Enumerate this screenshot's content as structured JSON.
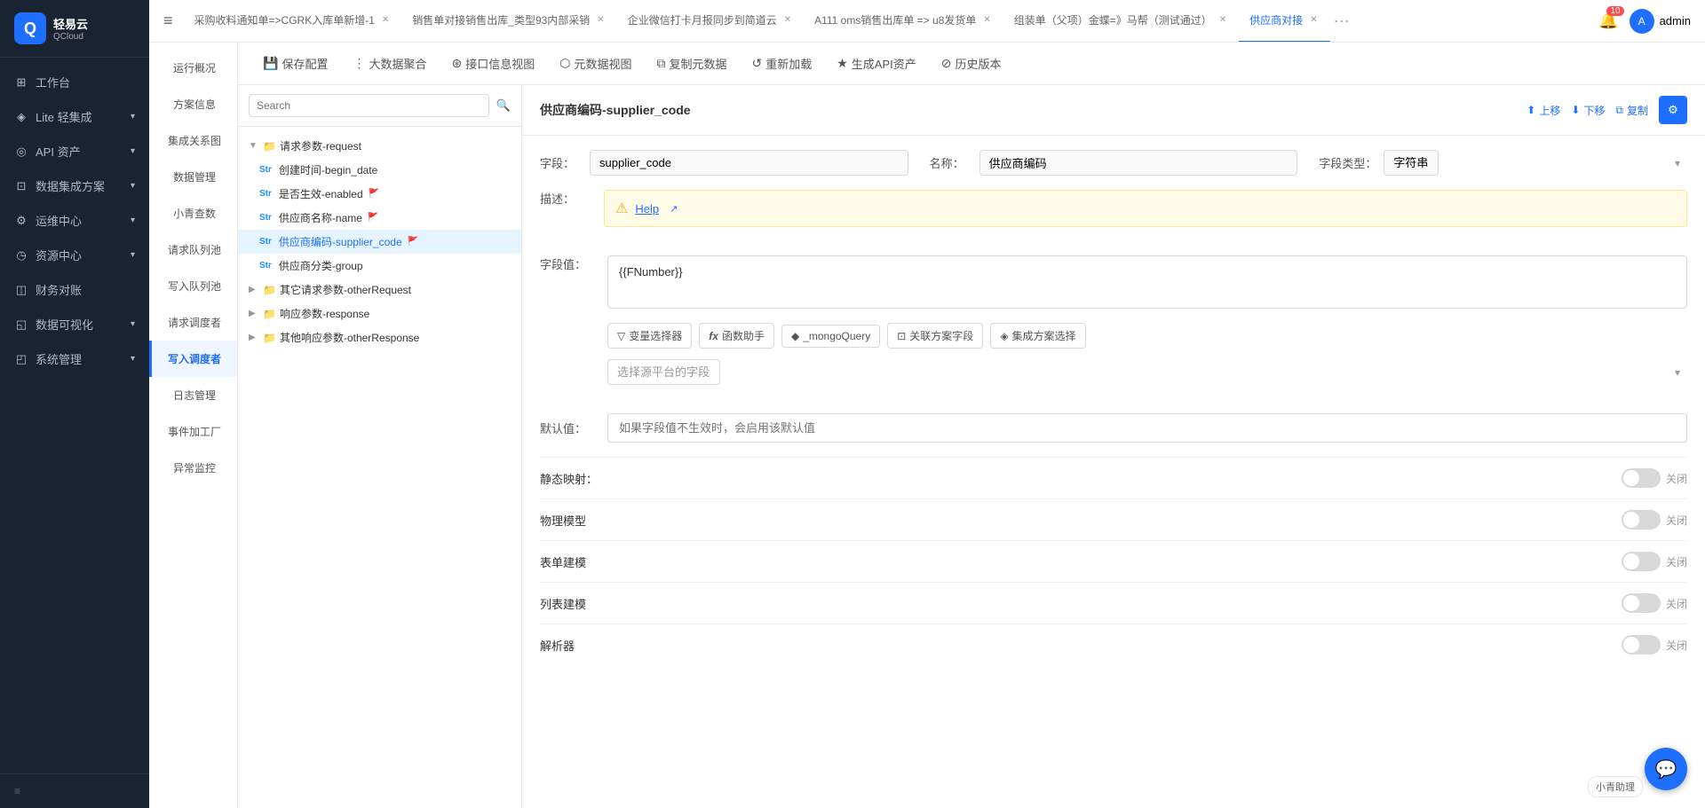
{
  "app": {
    "logo_text": "轻易云",
    "logo_sub": "QCloud",
    "menu_icon": "≡"
  },
  "sidebar": {
    "items": [
      {
        "id": "workbench",
        "label": "工作台",
        "icon": "⊞",
        "has_chevron": false
      },
      {
        "id": "lite",
        "label": "Lite 轻集成",
        "icon": "◈",
        "has_chevron": true
      },
      {
        "id": "api",
        "label": "API 资产",
        "icon": "◎",
        "has_chevron": true
      },
      {
        "id": "data",
        "label": "数据集成方案",
        "icon": "⊡",
        "has_chevron": true
      },
      {
        "id": "ops",
        "label": "运维中心",
        "icon": "⚙",
        "has_chevron": true
      },
      {
        "id": "resource",
        "label": "资源中心",
        "icon": "◷",
        "has_chevron": true
      },
      {
        "id": "finance",
        "label": "财务对账",
        "icon": "◫",
        "has_chevron": false
      },
      {
        "id": "visual",
        "label": "数据可视化",
        "icon": "◱",
        "has_chevron": true
      },
      {
        "id": "system",
        "label": "系统管理",
        "icon": "◰",
        "has_chevron": true
      }
    ],
    "bottom_icon": "≡"
  },
  "topbar": {
    "menu_icon": "≡",
    "tabs": [
      {
        "id": "tab1",
        "label": "采购收料通知单=>CGRK入库单新增-1",
        "active": false,
        "closable": true
      },
      {
        "id": "tab2",
        "label": "销售单对接销售出库_类型93内部采销",
        "active": false,
        "closable": true
      },
      {
        "id": "tab3",
        "label": "企业微信打卡月报同步到简道云",
        "active": false,
        "closable": true
      },
      {
        "id": "tab4",
        "label": "A111 oms销售出库单 => u8发货单",
        "active": false,
        "closable": true
      },
      {
        "id": "tab5",
        "label": "组装单（父项）金蝶=》马帮（测试通过）",
        "active": false,
        "closable": true
      },
      {
        "id": "tab6",
        "label": "供应商对接",
        "active": true,
        "closable": true
      }
    ],
    "more_icon": "···",
    "notification_count": "10",
    "admin_label": "admin"
  },
  "left_nav": {
    "items": [
      {
        "id": "overview",
        "label": "运行概况"
      },
      {
        "id": "info",
        "label": "方案信息"
      },
      {
        "id": "map",
        "label": "集成关系图"
      },
      {
        "id": "data_mgmt",
        "label": "数据管理"
      },
      {
        "id": "query",
        "label": "小青查数"
      },
      {
        "id": "req_queue",
        "label": "请求队列池"
      },
      {
        "id": "write_queue",
        "label": "写入队列池"
      },
      {
        "id": "req_observer",
        "label": "请求调度者"
      },
      {
        "id": "write_observer",
        "label": "写入调度者",
        "active": true
      },
      {
        "id": "log",
        "label": "日志管理"
      },
      {
        "id": "event_factory",
        "label": "事件加工厂"
      },
      {
        "id": "alarm",
        "label": "异常监控"
      }
    ]
  },
  "toolbar": {
    "buttons": [
      {
        "id": "save",
        "icon": "💾",
        "label": "保存配置"
      },
      {
        "id": "big_data",
        "icon": "⋮⋮",
        "label": "大数据聚合"
      },
      {
        "id": "interface_view",
        "icon": "⊛",
        "label": "接口信息视图"
      },
      {
        "id": "meta_view",
        "icon": "⬡",
        "label": "元数据视图"
      },
      {
        "id": "copy_meta",
        "icon": "⧉",
        "label": "复制元数据"
      },
      {
        "id": "reload",
        "icon": "↺",
        "label": "重新加载"
      },
      {
        "id": "gen_api",
        "icon": "★",
        "label": "生成API资产"
      },
      {
        "id": "history",
        "icon": "⊘",
        "label": "历史版本"
      }
    ]
  },
  "tree": {
    "search_placeholder": "Search",
    "nodes": [
      {
        "id": "req",
        "indent": 0,
        "type": "folder",
        "label": "请求参数-request",
        "expanded": true,
        "arrow": "▼"
      },
      {
        "id": "begin_date",
        "indent": 1,
        "type": "str",
        "label": "创建时间-begin_date",
        "flag": false
      },
      {
        "id": "enabled",
        "indent": 1,
        "type": "str",
        "label": "是否生效-enabled",
        "flag": true
      },
      {
        "id": "name",
        "indent": 1,
        "type": "str",
        "label": "供应商名称-name",
        "flag": true
      },
      {
        "id": "supplier_code",
        "indent": 1,
        "type": "str",
        "label": "供应商编码-supplier_code",
        "flag": true,
        "selected": true
      },
      {
        "id": "group",
        "indent": 1,
        "type": "str",
        "label": "供应商分类-group",
        "flag": false
      },
      {
        "id": "other_req",
        "indent": 0,
        "type": "folder",
        "label": "其它请求参数-otherRequest",
        "expanded": false,
        "arrow": "▶"
      },
      {
        "id": "resp",
        "indent": 0,
        "type": "folder",
        "label": "响应参数-response",
        "expanded": false,
        "arrow": "▶"
      },
      {
        "id": "other_resp",
        "indent": 0,
        "type": "folder",
        "label": "其他响应参数-otherResponse",
        "expanded": false,
        "arrow": "▶"
      }
    ]
  },
  "detail": {
    "title": "供应商编码-supplier_code",
    "actions": {
      "up": "上移",
      "down": "下移",
      "copy": "复制"
    },
    "field_label": "字段：",
    "field_value": "supplier_code",
    "name_label": "名称：",
    "name_value": "供应商编码",
    "type_label": "字段类型：",
    "type_value": "字符串",
    "desc_label": "描述：",
    "desc_help": "Help",
    "field_value_label": "字段值：",
    "field_value_content": "{{FNumber}}",
    "toolbar_buttons": [
      {
        "id": "var_selector",
        "icon": "▽",
        "label": "变量选择器"
      },
      {
        "id": "func_helper",
        "icon": "fx",
        "label": "函数助手"
      },
      {
        "id": "mongo_query",
        "icon": "◆",
        "label": "_mongoQuery"
      },
      {
        "id": "rel_field",
        "icon": "⊡",
        "label": "关联方案字段"
      },
      {
        "id": "integration_select",
        "icon": "◈",
        "label": "集成方案选择"
      }
    ],
    "source_placeholder": "选择源平台的字段",
    "default_label": "默认值：",
    "default_placeholder": "如果字段值不生效时，会启用该默认值",
    "static_map_label": "静态映射：",
    "static_map_status": "关闭",
    "physical_model_label": "物理模型",
    "physical_model_status": "关闭",
    "form_model_label": "表单建模",
    "form_model_status": "关闭",
    "list_model_label": "列表建模",
    "list_model_status": "关闭",
    "parser_label": "解析器",
    "parser_status": "关闭"
  },
  "colors": {
    "accent": "#1e6fff",
    "sidebar_bg": "#1a2332",
    "active_tab": "#1e6fff",
    "danger": "#ff4d4f",
    "warning": "#faad14",
    "success": "#52c41a"
  }
}
